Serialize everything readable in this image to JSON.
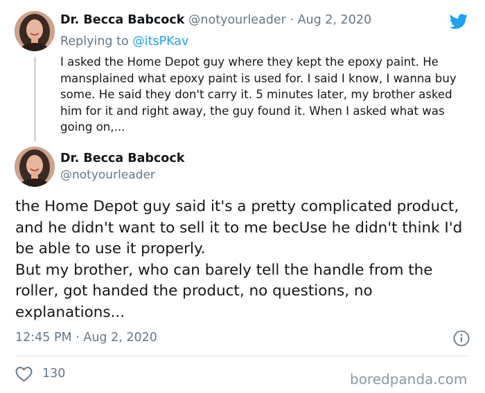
{
  "reply_tweet": {
    "author_name": "Dr. Becca Babcock",
    "author_handle": "@notyourleader",
    "separator": " · ",
    "date": "Aug 2, 2020",
    "replying_prefix": "Replying to ",
    "replying_to": "@itsPKav",
    "text": "I asked the Home Depot guy where they kept the epoxy paint. He mansplained what epoxy paint is used for. I said I know, I wanna buy some. He said they don't carry it. 5 minutes later, my brother asked him for it and right away, the guy found it. When I asked what was going on,..."
  },
  "main_tweet": {
    "author_name": "Dr. Becca Babcock",
    "author_handle": "@notyourleader",
    "text_paragraphs": [
      "the Home Depot guy said it's a pretty complicated product, and he didn't want to sell it to me becUse he didn't think I'd be able to use it properly.",
      "But my brother, who can barely tell the handle from the roller, got handed the product, no questions, no explanations..."
    ],
    "time": "12:45 PM",
    "separator": " · ",
    "date": "Aug 2, 2020",
    "likes": "130"
  },
  "icons": {
    "brand": "twitter-bird-icon",
    "info": "info-icon",
    "like": "heart-icon"
  },
  "colors": {
    "brand_blue": "#1da1f2",
    "secondary_text": "#657786",
    "primary_text": "#14171a",
    "thread_line": "#cfd9de",
    "divider": "#e1e8ed"
  },
  "watermark": "boredpanda.com"
}
